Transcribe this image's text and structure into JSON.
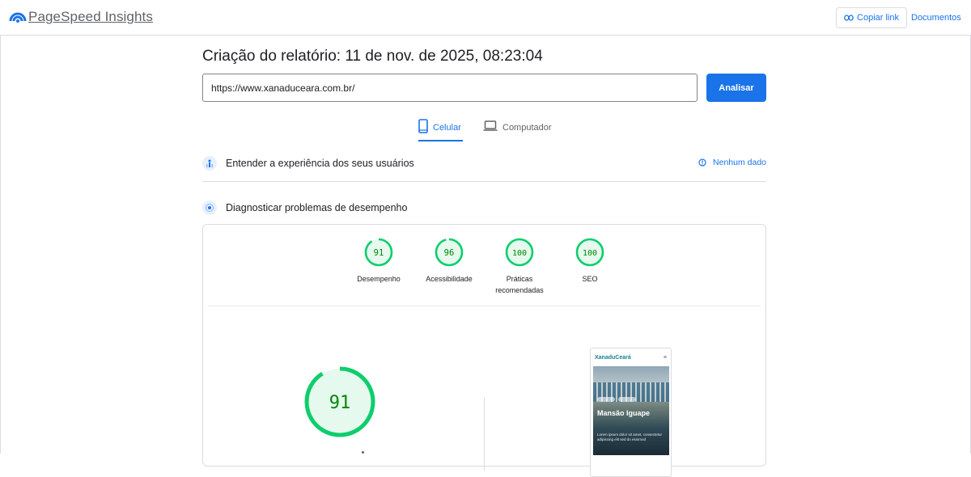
{
  "header": {
    "brand": "PageSpeed Insights",
    "copy_link": "Copiar link",
    "docs": "Documentos"
  },
  "report": {
    "title": "Criação do relatório: 11 de nov. de 2025, 08:23:04",
    "url_value": "https://www.xanaduceara.com.br/",
    "analyze_label": "Analisar"
  },
  "tabs": {
    "mobile": "Celular",
    "desktop": "Computador"
  },
  "sections": {
    "experience": "Entender a experiência dos seus usuários",
    "no_data": "Nenhum dado",
    "diagnose": "Diagnosticar problemas de desempenho"
  },
  "scores": [
    {
      "label": "Desempenho",
      "value": "91"
    },
    {
      "label": "Acessibilidade",
      "value": "96"
    },
    {
      "label": "Práticas recomendadas",
      "value": "100"
    },
    {
      "label": "SEO",
      "value": "100"
    }
  ],
  "main_score": "91",
  "preview": {
    "brand": "XanaduCeará",
    "menu_icon": "≡",
    "headline": "Mansão Iguape",
    "body": "Lorem ipsum dolor sit amet, consectetur adipiscing elit sed do eiusmod"
  },
  "colors": {
    "accent": "#1a73e8",
    "pass": "#0cce6b",
    "pass_text": "#008800",
    "pass_bg": "#e6f9ee"
  }
}
